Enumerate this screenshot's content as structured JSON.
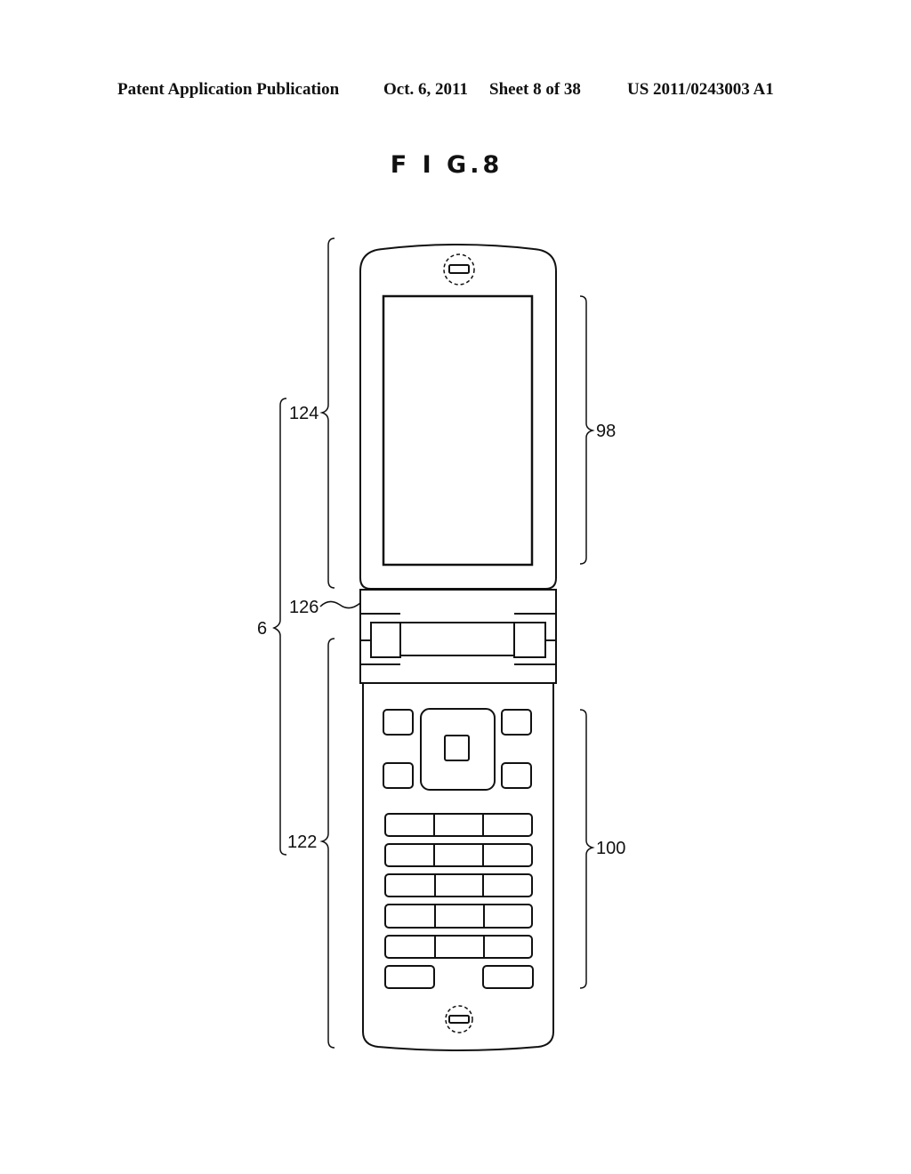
{
  "header": {
    "publication": "Patent Application Publication",
    "date": "Oct. 6, 2011",
    "sheet": "Sheet 8 of 38",
    "number": "US 2011/0243003 A1"
  },
  "figure": {
    "title": "F I G.8",
    "labels": {
      "upper_housing": "124",
      "display": "98",
      "hinge": "126",
      "device": "6",
      "lower_housing": "122",
      "keypad": "100"
    }
  }
}
